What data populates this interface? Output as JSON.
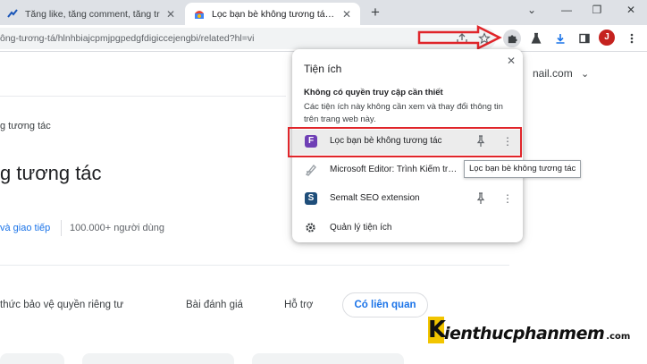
{
  "tabs": [
    {
      "title": "Tăng like, tăng comment, tăng tr",
      "active": false
    },
    {
      "title": "Lọc bạn bè không tương tác - Cl",
      "active": true
    }
  ],
  "address_bar": {
    "url": "ông-tương-tá/hlnhbiajcpmjpgpedgfdigiccejengbi/related?hl=vi"
  },
  "account": {
    "email_partial": "nail.com",
    "avatar_letter": "J"
  },
  "page": {
    "breadcrumb": "g tương tác",
    "title": "g tương tác",
    "category_link": "và giao tiếp",
    "users_count": "100.000+ người dùng",
    "tabs": [
      {
        "label": "thức bảo vệ quyền riêng tư",
        "active": false
      },
      {
        "label": "Bài đánh giá",
        "active": false
      },
      {
        "label": "Hỗ trợ",
        "active": false
      },
      {
        "label": "Có liên quan",
        "active": true
      }
    ]
  },
  "extensions_popup": {
    "title": "Tiện ích",
    "no_access_heading": "Không có quyền truy cập cần thiết",
    "no_access_description": "Các tiện ích này không cần xem và thay đổi thông tin trên trang web này.",
    "extensions": [
      {
        "name": "Lọc bạn bè không tương tác",
        "icon_letter": "F",
        "icon_color": "#6f3fb5",
        "highlighted": true
      },
      {
        "name": "Microsoft Editor: Trình Kiểm tra...",
        "icon_letter": "",
        "icon_color": "#9aa0a6",
        "highlighted": false
      },
      {
        "name": "Semalt SEO extension",
        "icon_letter": "S",
        "icon_color": "#1f4e7a",
        "highlighted": false
      }
    ],
    "manage_label": "Quản lý tiện ích"
  },
  "tooltip": "Lọc bạn bè không tương tác",
  "watermark": {
    "first_letter": "K",
    "text": "ienthucphanmem",
    "suffix": ".com"
  },
  "colors": {
    "accent_blue": "#1a73e8",
    "annotation_red": "#e0252a",
    "tabstrip_bg": "#dee1e6"
  }
}
